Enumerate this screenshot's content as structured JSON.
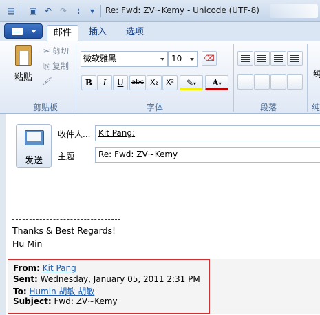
{
  "window": {
    "title": "Re: Fwd: ZV~Kemy - Unicode (UTF-8)"
  },
  "ribbon": {
    "tabs": [
      "邮件",
      "插入",
      "选项"
    ],
    "clipboard": {
      "group_label": "剪贴板",
      "paste": "粘贴",
      "cut": "剪切",
      "copy": "复制"
    },
    "font": {
      "group_label": "字体",
      "font_name": "微软雅黑",
      "font_size": "10",
      "bold": "B",
      "italic": "I",
      "underline": "U",
      "strike": "abc",
      "subscript": "X₂",
      "superscript": "X²",
      "highlight": "A",
      "font_color": "A"
    },
    "paragraph": {
      "group_label": "段落"
    },
    "cutoff_label": "纯",
    "cutoff_group": "纯"
  },
  "compose": {
    "send_label": "发送",
    "to_label": "收件人...",
    "to_value": "Kit Pang;",
    "subject_label": "主题",
    "subject_value": "Re: Fwd: ZV~Kemy"
  },
  "body": {
    "separator": "~~~~~~~~~~~~~~~~~~~~~~~~~~~~~~~~~~~~~~~~~~",
    "regards": "Thanks & Best Regards!",
    "name": "Hu Min"
  },
  "quoted": {
    "from_key": "From:",
    "from_val": "Kit Pang",
    "sent_key": "Sent:",
    "sent_val": "Wednesday, January 05, 2011 2:31 PM",
    "to_key": "To:",
    "to_val": "Humin 胡敏  胡敏",
    "subject_key": "Subject:",
    "subject_val": "Fwd: ZV~Kemy"
  }
}
